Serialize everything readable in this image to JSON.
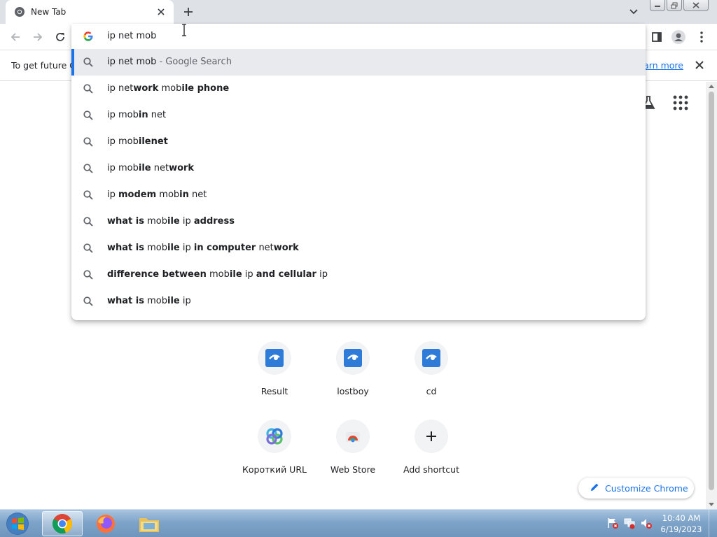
{
  "tab": {
    "title": "New Tab"
  },
  "omnibox": {
    "input": "ip net mob",
    "suggestions": [
      {
        "parts": [
          {
            "t": "ip net mob",
            "b": false
          }
        ],
        "suffix": " - Google Search",
        "selected": true
      },
      {
        "parts": [
          {
            "t": "ip net",
            "b": false
          },
          {
            "t": "work",
            "b": true
          },
          {
            "t": " mob",
            "b": false
          },
          {
            "t": "ile phone",
            "b": true
          }
        ]
      },
      {
        "parts": [
          {
            "t": "ip mob",
            "b": false
          },
          {
            "t": "in",
            "b": true
          },
          {
            "t": " net",
            "b": false
          }
        ]
      },
      {
        "parts": [
          {
            "t": "ip mob",
            "b": false
          },
          {
            "t": "ilenet",
            "b": true
          }
        ]
      },
      {
        "parts": [
          {
            "t": "ip mob",
            "b": false
          },
          {
            "t": "ile",
            "b": true
          },
          {
            "t": " net",
            "b": false
          },
          {
            "t": "work",
            "b": true
          }
        ]
      },
      {
        "parts": [
          {
            "t": "ip ",
            "b": false
          },
          {
            "t": "modem",
            "b": true
          },
          {
            "t": " mob",
            "b": false
          },
          {
            "t": "in",
            "b": true
          },
          {
            "t": " net",
            "b": false
          }
        ]
      },
      {
        "parts": [
          {
            "t": "what is",
            "b": true
          },
          {
            "t": " mob",
            "b": false
          },
          {
            "t": "ile",
            "b": true
          },
          {
            "t": " ip ",
            "b": false
          },
          {
            "t": "address",
            "b": true
          }
        ]
      },
      {
        "parts": [
          {
            "t": "what is",
            "b": true
          },
          {
            "t": " mob",
            "b": false
          },
          {
            "t": "ile",
            "b": true
          },
          {
            "t": " ip ",
            "b": false
          },
          {
            "t": "in computer",
            "b": true
          },
          {
            "t": " net",
            "b": false
          },
          {
            "t": "work",
            "b": true
          }
        ]
      },
      {
        "parts": [
          {
            "t": "difference between",
            "b": true
          },
          {
            "t": " mob",
            "b": false
          },
          {
            "t": "ile",
            "b": true
          },
          {
            "t": " ip ",
            "b": false
          },
          {
            "t": "and cellular",
            "b": true
          },
          {
            "t": " ip",
            "b": false
          }
        ]
      },
      {
        "parts": [
          {
            "t": "what is",
            "b": true
          },
          {
            "t": " mob",
            "b": false
          },
          {
            "t": "ile",
            "b": true
          },
          {
            "t": " ip",
            "b": false
          }
        ]
      }
    ]
  },
  "infobar": {
    "message": "To get future G",
    "learn_more": "Learn more"
  },
  "shortcuts": [
    {
      "label": "Result",
      "icon": "ucoz-icon"
    },
    {
      "label": "lostboy",
      "icon": "ucoz-icon"
    },
    {
      "label": "cd",
      "icon": "ucoz-icon"
    },
    {
      "label": "Короткий URL",
      "icon": "short-url-icon"
    },
    {
      "label": "Web Store",
      "icon": "web-store-icon"
    },
    {
      "label": "Add shortcut",
      "icon": "plus-icon"
    }
  ],
  "customize": {
    "label": "Customize Chrome"
  },
  "taskbar": {
    "time": "10:40 AM",
    "date": "6/19/2023"
  },
  "colors": {
    "accent": "#1a73e8",
    "selected_row": "#e8eaed",
    "titlebar": "#dee1e6"
  }
}
